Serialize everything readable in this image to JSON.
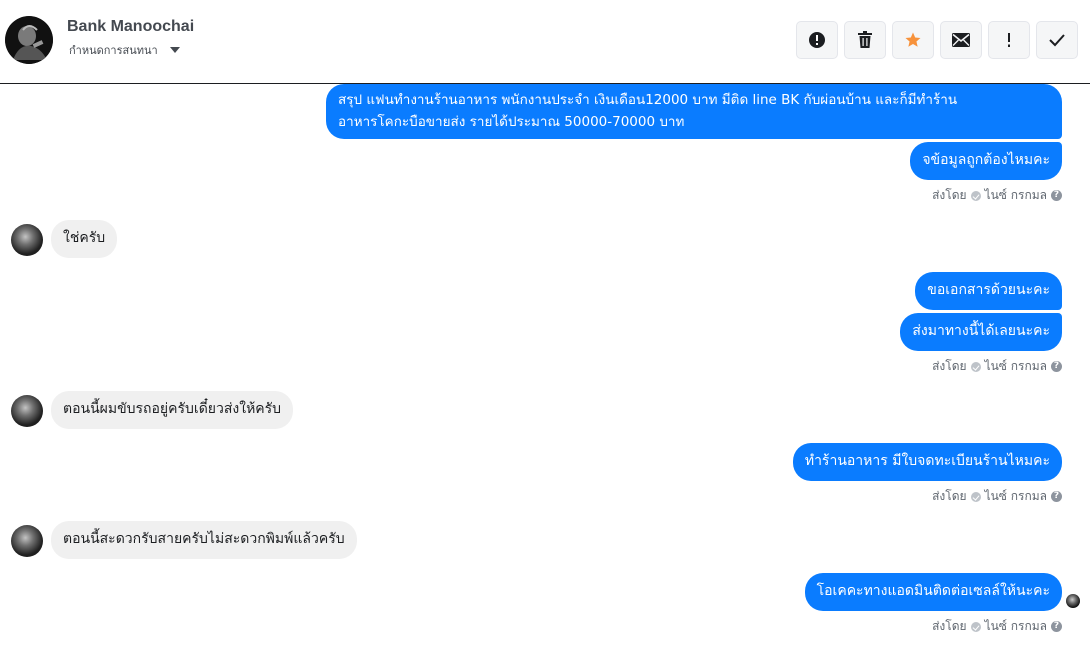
{
  "header": {
    "name": "Bank Manoochai",
    "assign_label": "กำหนดการสนทนา"
  },
  "actions": [
    {
      "icon": "alert-circle-icon",
      "label": "!"
    },
    {
      "icon": "trash-icon"
    },
    {
      "icon": "star-icon",
      "color": "#f7923b"
    },
    {
      "icon": "mail-icon"
    },
    {
      "icon": "exclamation-icon",
      "label": "!"
    },
    {
      "icon": "check-icon"
    }
  ],
  "messages": {
    "m1_line1": "สรุป แฟนทำงานร้านอาหาร  พนักงานประจำ เงินเดือน12000 บาท มีติด line BK กับผ่อนบ้าน  และก็มีทำร้าน",
    "m1_line2": "อาหารโคกะบือขายส่ง รายได้ประมาณ 50000-70000 บาท",
    "m2": "จข้อมูลถูกต้องไหมคะ",
    "m3": "ใช่ครับ",
    "m4": "ขอเอกสารด้วยนะคะ",
    "m5": "ส่งมาทางนี้ได้เลยนะคะ",
    "m6": "ตอนนี้ผมขับรถอยู่ครับเดี๋ยวส่งให้ครับ",
    "m7": "ทำร้านอาหาร มีใบจดทะเบียนร้านไหมคะ",
    "m8": "ตอนนี้สะดวกรับสายครับไม่สะดวกพิมพ์แล้วครับ",
    "m9": "โอเคคะทางแอดมินติดต่อเซลล์ให้นะคะ"
  },
  "sent_by": {
    "prefix": "ส่งโดย",
    "agent": "ไนซ์ กรกมล"
  },
  "colors": {
    "outgoing": "#0a7cff",
    "incoming": "#f0f0f0",
    "star": "#f7923b"
  }
}
